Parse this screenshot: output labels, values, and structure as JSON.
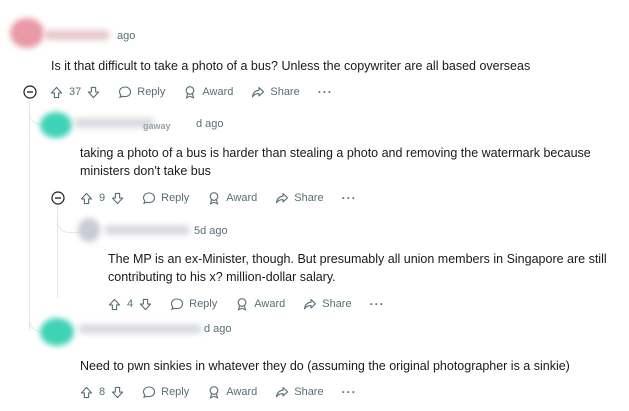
{
  "comments": [
    {
      "time": "ago",
      "body": "Is it that difficult to take a photo of a bus? Unless the copywriter are all based overseas",
      "votes": "37",
      "reply": "Reply",
      "award": "Award",
      "share": "Share"
    },
    {
      "name_fragment": "gaway",
      "time": "d ago",
      "body_line1": "taking a photo of a bus is harder than stealing a photo and removing the watermark because",
      "body_line2": "ministers don't take bus",
      "votes": "9",
      "reply": "Reply",
      "award": "Award",
      "share": "Share"
    },
    {
      "time": "5d ago",
      "body_line1": "The MP is an ex-Minister, though. But presumably all union members in Singapore are still",
      "body_line2": "contributing to his x? million-dollar salary.",
      "votes": "4",
      "reply": "Reply",
      "award": "Award",
      "share": "Share"
    },
    {
      "time": "d ago",
      "body": "Need to pwn sinkies in whatever they do (assuming the original photographer is a sinkie)",
      "votes": "8",
      "reply": "Reply",
      "award": "Award",
      "share": "Share"
    }
  ],
  "more_label": "···",
  "colors": {
    "muted": "#576f76",
    "thread": "#e5e7eb",
    "avatar_red": "#e8a0a8",
    "avatar_teal": "#3fd3b5"
  }
}
